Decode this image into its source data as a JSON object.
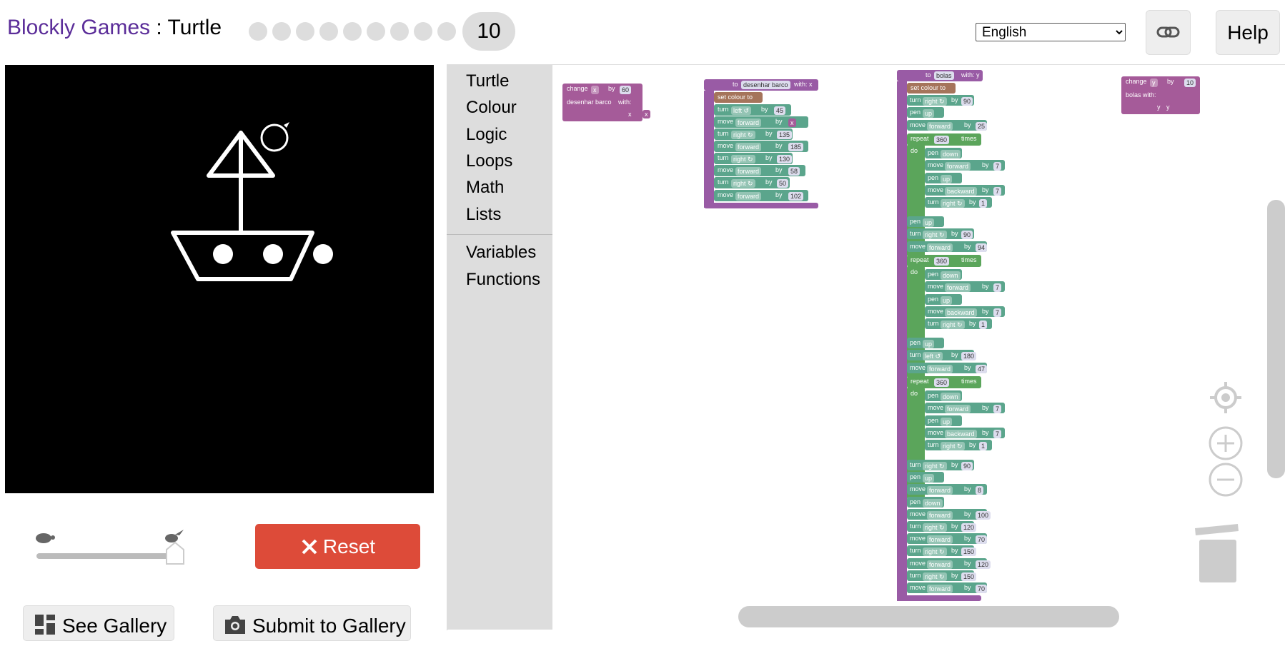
{
  "header": {
    "app_name": "Blockly Games",
    "separator": " : ",
    "game_name": "Turtle",
    "current_level": "10",
    "language": "English",
    "help_label": "Help"
  },
  "controls": {
    "reset_label": "Reset",
    "see_gallery_label": "See Gallery",
    "submit_gallery_label": "Submit to Gallery"
  },
  "toolbox": {
    "items": [
      "Turtle",
      "Colour",
      "Logic",
      "Loops",
      "Math",
      "Lists"
    ],
    "items2": [
      "Variables",
      "Functions"
    ]
  },
  "blocks": {
    "b1": {
      "change": "change",
      "var": "x",
      "by": "by",
      "val": "60",
      "call": "desenhar barco",
      "with": "with:",
      "param": "x",
      "arg": "x"
    },
    "b2": {
      "to": "to",
      "name": "desenhar barco",
      "with": "with: x",
      "setc": "set colour to",
      "rows": [
        [
          "turn",
          "left ↺",
          "by",
          "45"
        ],
        [
          "move",
          "forward",
          "by",
          "x"
        ],
        [
          "turn",
          "right ↻",
          "by",
          "135"
        ],
        [
          "move",
          "forward",
          "by",
          "185"
        ],
        [
          "turn",
          "right ↻",
          "by",
          "130"
        ],
        [
          "move",
          "forward",
          "by",
          "58"
        ],
        [
          "turn",
          "right ↻",
          "by",
          "50"
        ],
        [
          "move",
          "forward",
          "by",
          "102"
        ]
      ]
    },
    "b3": {
      "to": "to",
      "name": "bolas",
      "with": "with: y",
      "setc": "set colour to",
      "repeat": "repeat",
      "times": "times",
      "do": "do",
      "pen": "pen",
      "up": "up",
      "down": "down"
    },
    "b4": {
      "change": "change",
      "var": "y",
      "by": "by",
      "val": "10",
      "call": "bolas",
      "with": "with:",
      "param": "y",
      "arg": "y"
    }
  },
  "colors": {
    "brand": "#5b2d99",
    "reset": "#dd4b39",
    "turtle_block": "#5ba58c",
    "loop_block": "#5ba55b",
    "function_block": "#995ba5",
    "variable_block": "#a55b99"
  }
}
